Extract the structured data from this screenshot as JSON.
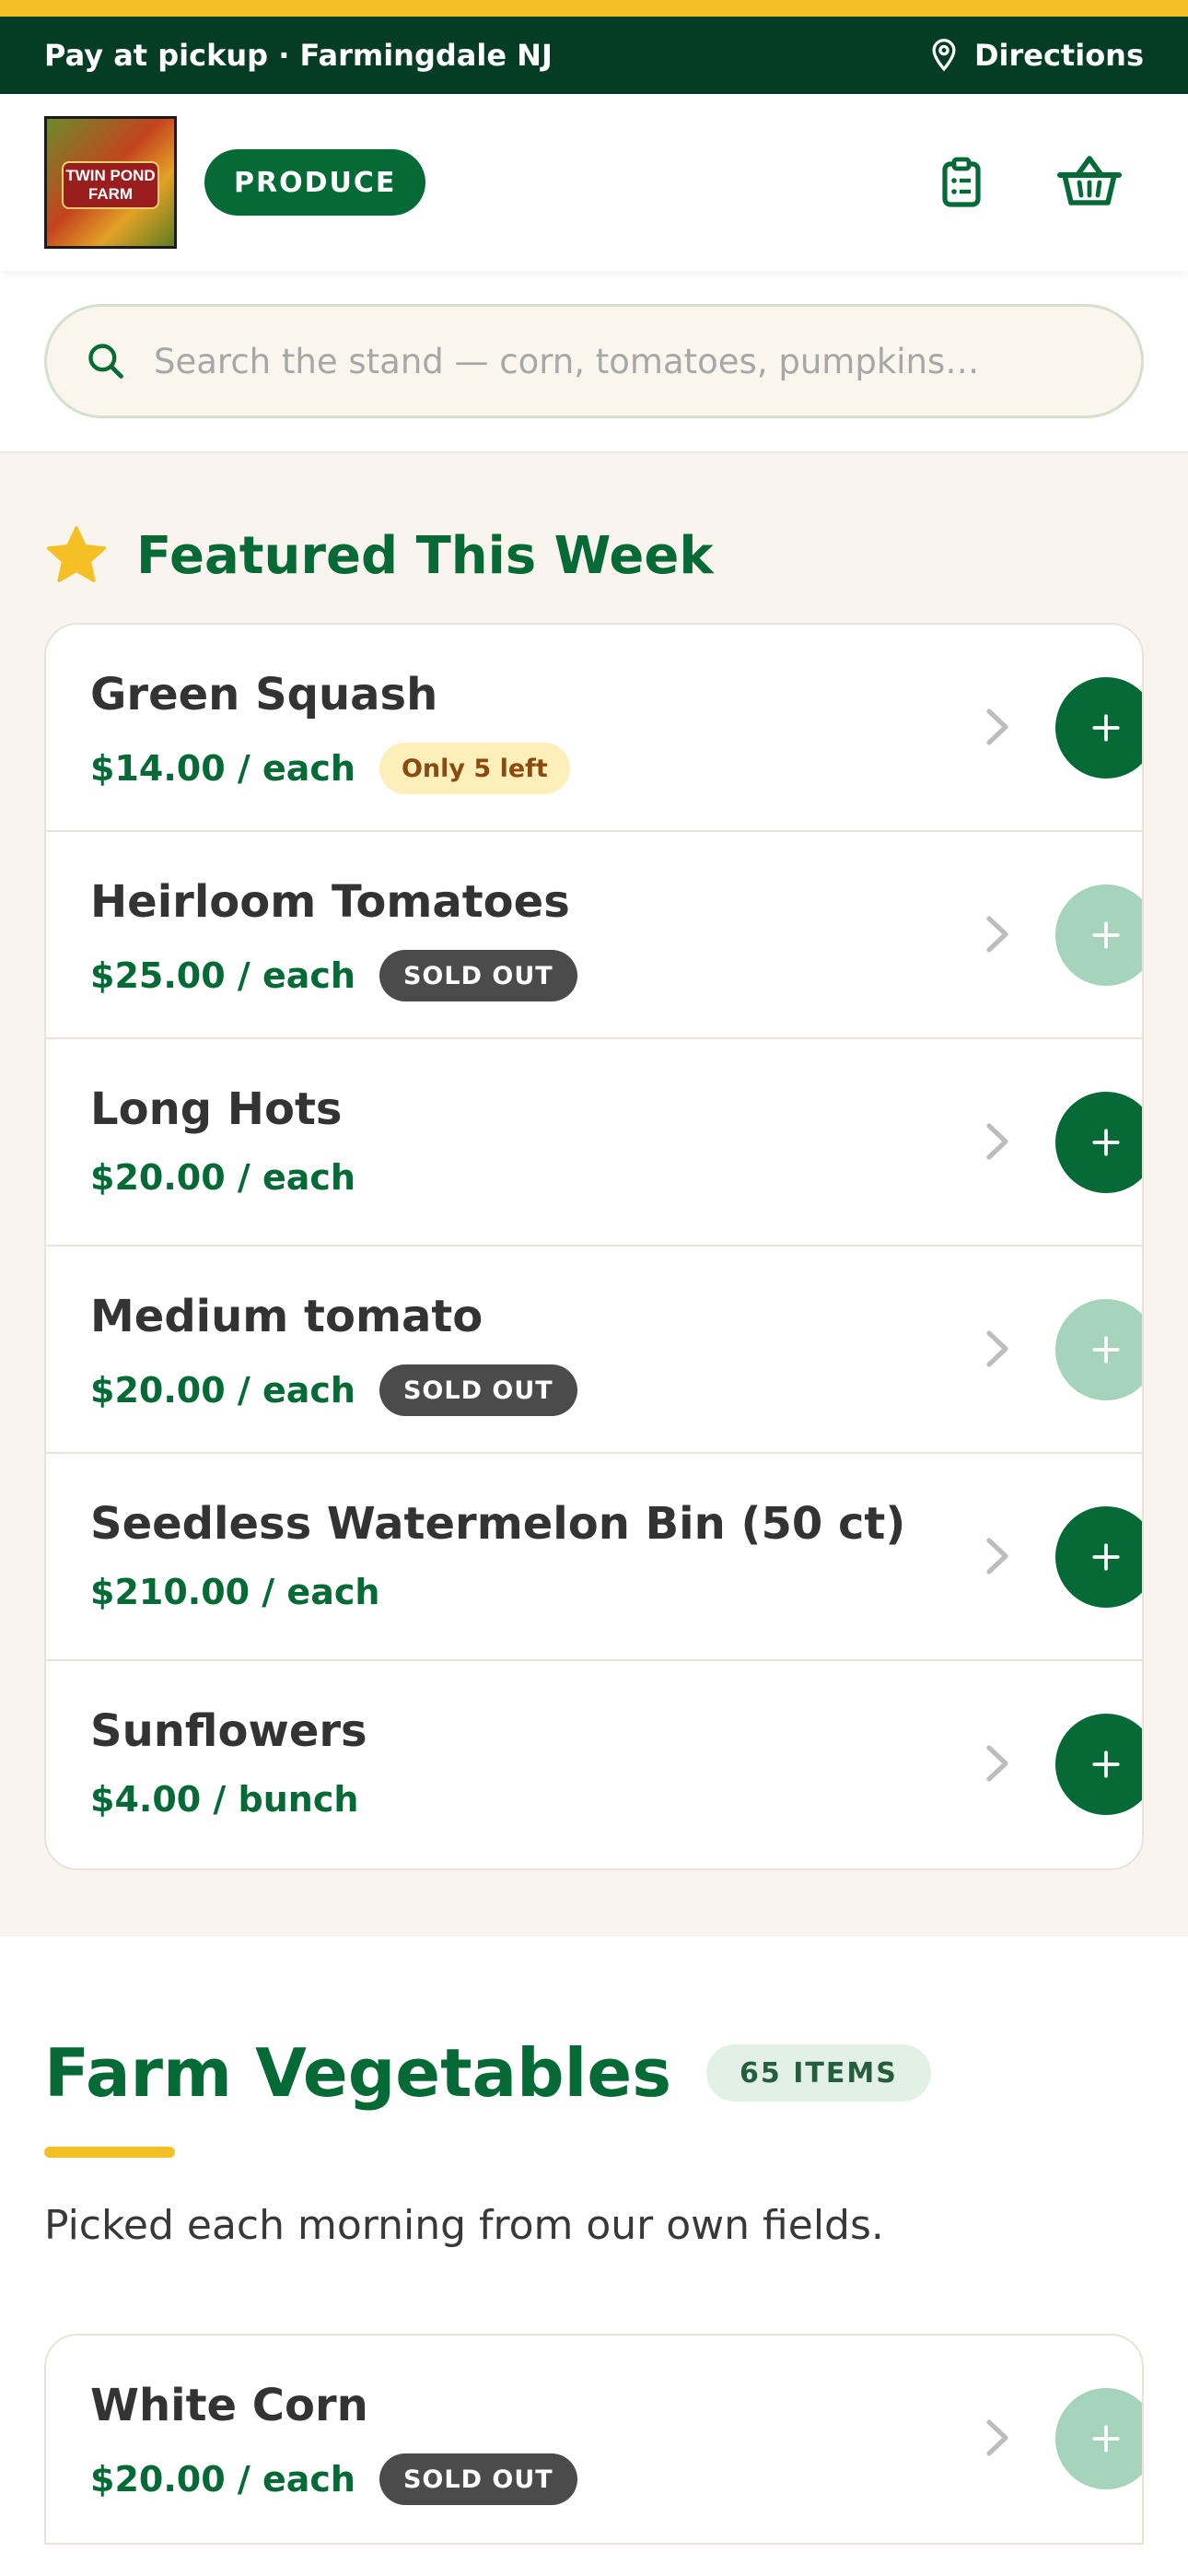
{
  "topbar": {
    "message": "Pay at pickup · Farmingdale NJ",
    "directions_label": "Directions"
  },
  "header": {
    "logo_text": "TWIN POND FARM",
    "category_pill": "PRODUCE"
  },
  "search": {
    "placeholder": "Search the stand — corn, tomatoes, pumpkins…"
  },
  "featured": {
    "title": "Featured This Week",
    "items": [
      {
        "name": "Green Squash",
        "price": "$14.00 / each",
        "badge": "Only 5 left"
      },
      {
        "name": "Heirloom Tomatoes",
        "price": "$25.00 / each",
        "badge": "SOLD OUT"
      },
      {
        "name": "Long Hots",
        "price": "$20.00 / each"
      },
      {
        "name": "Medium tomato",
        "price": "$20.00 / each",
        "badge": "SOLD OUT"
      },
      {
        "name": "Seedless Watermelon Bin (50 ct)",
        "price": "$210.00 / each"
      },
      {
        "name": "Sunflowers",
        "price": "$4.00 / bunch"
      }
    ]
  },
  "vegetables": {
    "title": "Farm Vegetables",
    "count": "65 ITEMS",
    "subtitle": "Picked each morning from our own fields.",
    "items": [
      {
        "name": "White Corn",
        "price": "$20.00 / each",
        "badge": "SOLD OUT"
      }
    ]
  },
  "colors": {
    "brand_green": "#066a36",
    "dark_green": "#043c24",
    "accent_yellow": "#f5c026"
  }
}
